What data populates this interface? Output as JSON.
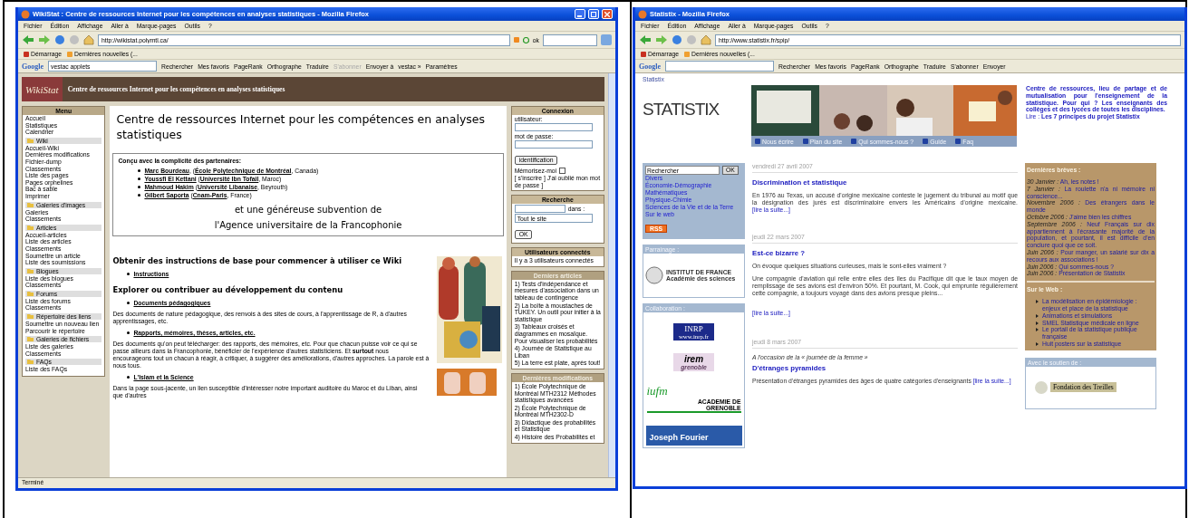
{
  "wikistat_window": {
    "title": "WikiStat : Centre de ressources Internet pour les compétences en analyses statistiques - Mozilla Firefox",
    "window_buttons": true,
    "menu": [
      "Fichier",
      "Édition",
      "Affichage",
      "Aller à",
      "Marque-pages",
      "Outils",
      "?"
    ],
    "address": "http://wikistat.polymtl.ca/",
    "go_label": "ok",
    "bookmarks": [
      "Démarrage",
      "Dernières nouvelles (..."
    ],
    "google": {
      "logo": "Google",
      "query": "vestac applets",
      "buttons": [
        {
          "label": "Rechercher",
          "disabled": false
        },
        {
          "label": "Mes favoris",
          "disabled": false
        },
        {
          "label": "PageRank",
          "disabled": false
        },
        {
          "label": "Orthographe",
          "disabled": false
        },
        {
          "label": "Traduire",
          "disabled": false
        },
        {
          "label": "S'abonner",
          "disabled": true
        },
        {
          "label": "Envoyer à",
          "disabled": false
        },
        {
          "label": "vestac »",
          "disabled": false
        },
        {
          "label": "Paramètres",
          "disabled": false
        }
      ]
    },
    "status": "Terminé",
    "page": {
      "logo": "WikiStat",
      "header": "Centre de ressources Internet pour les compétences en analyses statistiques",
      "menu": {
        "title": "Menu",
        "links": [
          "Accueil",
          "Statistiques",
          "Calendrier"
        ],
        "sections": [
          {
            "title": "Wiki",
            "links": [
              "Accueil-Wiki",
              "Dernières modifications",
              "Fichier-dump",
              "Classements",
              "Liste des pages",
              "Pages orphelines",
              "Bac à sable",
              "Imprimer"
            ]
          },
          {
            "title": "Galeries d'images",
            "links": [
              "Galeries",
              "Classements"
            ]
          },
          {
            "title": "Articles",
            "links": [
              "Accueil-articles",
              "Liste des articles",
              "Classements",
              "Soumettre un article",
              "Liste des soumissions"
            ]
          },
          {
            "title": "Blogues",
            "links": [
              "Liste des blogues",
              "Classements"
            ]
          },
          {
            "title": "Forums",
            "links": [
              "Liste des forums",
              "Classements"
            ]
          },
          {
            "title": "Répertoire des liens",
            "links": [
              "Soumettre un nouveau lien",
              "Parcourir le répertoire"
            ]
          },
          {
            "title": "Galeries de fichiers",
            "links": [
              "Liste des galeries",
              "Classements"
            ]
          },
          {
            "title": "FAQs",
            "links": [
              "Liste des FAQs"
            ]
          }
        ]
      },
      "heading": "Centre de ressources Internet pour les compétences en analyses statistiques",
      "partners": {
        "intro": "Conçu avec la complicité des partenaires:",
        "people": [
          "**Marc Bourdeau**, (**École Polytechnique de Montréal**, Canada)",
          "**Youssfi El Kettani** (**Université Ibn Tofail**, Maroc)",
          "**Mahmoud Hakim** (**Université Libanaise**, Beyrouth)",
          "**Gilbert Saporta** (**Cnam-Paris**, France)"
        ],
        "grant_lines": [
          "et une généreuse subvention de",
          "l'Agence universitaire de la Francophonie"
        ]
      },
      "sections": [
        {
          "heading": "Obtenir des instructions de base pour commencer à utiliser ce Wiki",
          "items": [
            {
              "link": "Instructions"
            }
          ]
        },
        {
          "heading": "Explorer ou contribuer au développement du contenu",
          "items": [
            {
              "link": "Documents pédagogiques",
              "text": "Des documents de nature pédagogique, des renvois à des sites de cours, à l'apprentissage de R, à d'autres apprentissages, etc."
            },
            {
              "link": "Rapports, mémoires, thèses, articles, etc.",
              "text": "Des documents qu'on peut télécharger: des rapports, des mémoires, etc. Pour que chacun puisse voir ce qui se passe ailleurs dans la Francophonie, bénéficier de l'expérience d'autres statisticiens. Et **surtout** nous encourageons tout un chacun à réagir, à critiquer, à suggérer des améliorations, d'autres approches. La parole est à nous tous."
            },
            {
              "link": "L'Islam et la Science",
              "text": "Dans la page sous-jacente, un lien susceptible d'intéresser notre important auditoire du Maroc et du Liban, ainsi que d'autres"
            }
          ]
        }
      ],
      "sidebar": {
        "login": {
          "title": "Connexion",
          "user_label": "utilisateur:",
          "password_label": "mot de passe:",
          "button": "identification",
          "remember": {
            "label": "Mémorisez-moi",
            "checked": false
          },
          "links": "[ s'inscrire ] J'ai oublié mon mot de passe ]"
        },
        "search": {
          "title": "Recherche",
          "scope_label": "dans :",
          "scope": "Tout le site",
          "button": "OK"
        },
        "users": {
          "title": "Utilisateurs connectés",
          "text": "Il y a 3 utilisateurs connectés"
        },
        "articles": {
          "title": "Derniers articles",
          "items": [
            "1) Tests d'indépendance et mesures d'association dans un tableau de contingence",
            "2) La boîte à moustaches de TUKEY. Un outil pour initier à la statistique",
            "3) Tableaux croisés et diagrammes en mosaïque. Pour visualiser les probabilités",
            "4) Journée de Statistique au Liban",
            "5) La terre est plate, après tout!"
          ]
        },
        "changes": {
          "title": "Dernières modifications",
          "items": [
            "1) École Polytechnique de Montréal MTH2312 Méthodes statistiques avancées",
            "2) École Polytechnique de Montréal MTH2302-D",
            "3) Didactique des probabilités et Statistique",
            "4) Histoire des Probabilités et"
          ]
        }
      }
    }
  },
  "statistix_window": {
    "title": "Statistix - Mozilla Firefox",
    "menu": [
      "Fichier",
      "Édition",
      "Affichage",
      "Aller à",
      "Marque-pages",
      "Outils",
      "?"
    ],
    "address": "http://www.statistix.fr/spip/",
    "bookmarks": [
      "Démarrage",
      "Dernières nouvelles (..."
    ],
    "google": {
      "logo": "Google",
      "buttons": [
        {
          "label": "Rechercher",
          "disabled": false
        },
        {
          "label": "Mes favoris",
          "disabled": false
        },
        {
          "label": "PageRank",
          "disabled": false
        },
        {
          "label": "Orthographe",
          "disabled": false
        },
        {
          "label": "Traduire",
          "disabled": false
        },
        {
          "label": "S'abonner",
          "disabled": false
        },
        {
          "label": "Envoyer",
          "disabled": false
        }
      ]
    },
    "page": {
      "breadcrumb": "Statistix",
      "logo": "STATISTIX",
      "nav": [
        "Nous écrire",
        "Plan du site",
        "Qui sommes-nous ?",
        "Guide",
        "Faq"
      ],
      "intro": "Centre de ressources, lieu de partage et de mutualisation pour l'enseignement de la statistique. Pour qui ? Les enseignants des collèges et des lycées de toutes les disciplines.",
      "read": "Lire : **Les 7 principes du projet Statistix**",
      "search": {
        "value": "Rechercher",
        "button": "OK"
      },
      "categories": [
        "Divers",
        "Économie-Démographie",
        "Mathématiques",
        "Physique-Chimie",
        "Sciences de la Vie et de la Terre",
        "Sur le web"
      ],
      "rss": "RSS",
      "sponsor": {
        "title": "Parrainage :",
        "lines": [
          "INSTITUT DE FRANCE",
          "Académie des sciences"
        ]
      },
      "collaboration": {
        "title": "Collaboration :",
        "logos": [
          {
            "kind": "inrp",
            "lines": [
              "INRP",
              "www.inrp.fr"
            ]
          },
          {
            "kind": "irem",
            "lines": [
              "irem",
              "grenoble"
            ]
          },
          {
            "kind": "iufm",
            "lines": [
              "iufm",
              "ACADEMIE DE",
              "GRENOBLE"
            ]
          },
          {
            "kind": "ujf",
            "lines": [
              "Joseph Fourier"
            ]
          }
        ]
      },
      "articles": [
        {
          "date": "vendredi 27 avril 2007",
          "title": "Discrimination et statistique",
          "body": "En 1976 au Texas, un accusé d'origine mexicaine conteste le jugement du tribunal au motif que la désignation des jurés est discriminatoire envers les Américains d'origine mexicaine.",
          "more": "[lire la suite...]"
        },
        {
          "date": "jeudi 22 mars 2007",
          "title": "Est-ce bizarre ?",
          "intro": "On évoque quelques situations curieuses, mais le sont-elles vraiment ?",
          "body": "Une compagnie d'aviation qui relie entre elles des îles du Pacifique dit que le taux moyen de remplissage de ses avions est d'environ 50%. Et pourtant, M. Cook, qui emprunte régulièrement cette compagnie, a toujours voyagé dans des avions presque pleins...",
          "more": "[lire la suite...]",
          "more_block": true
        },
        {
          "date": "jeudi 8 mars 2007",
          "surtitle": "A l'occasion de la « journée de la femme »",
          "title": "D'étranges pyramides",
          "body": "Présentation d'étranges pyramides des âges de quatre catégories d'enseignants",
          "more": "[lire la suite...]"
        }
      ],
      "briefs": {
        "title": "Dernières brèves :",
        "items": [
          {
            "date": "30 Janvier :",
            "text": "Ah, les notes !"
          },
          {
            "date": "7 Janvier :",
            "text": "La roulette n'a ni mémoire ni conscience..."
          },
          {
            "date": "Novembre 2006 :",
            "text": "Des étrangers dans le monde"
          },
          {
            "date": "Octobre 2006 :",
            "text": "J'aime bien les chiffres"
          },
          {
            "date": "Septembre 2006 :",
            "text": "Neuf Français sur dix appartiennent à l'écrasante majorité de la population, et pourtant, il est difficile d'en conclure quoi que ce soit."
          },
          {
            "date": "Juin 2006 :",
            "text": "Pour manger, un salarié sur dix a recours aux associations !"
          },
          {
            "date": "Juin 2006 :",
            "text": "Qui sommes-nous ?"
          },
          {
            "date": "Juin 2006 :",
            "text": "Présentation de Statistix"
          }
        ]
      },
      "web": {
        "title": "Sur le Web :",
        "items": [
          "La modélisation en épidémiologie : enjeux et place de la statistique",
          "Animations et simulations",
          "SMEL Statistique médicale en ligne",
          "Le portail de la statistique publique française",
          "Huit posters sur la statistique"
        ]
      },
      "support": {
        "title": "Avec le soutien de :",
        "logo": "Fondation des Treilles"
      }
    }
  }
}
